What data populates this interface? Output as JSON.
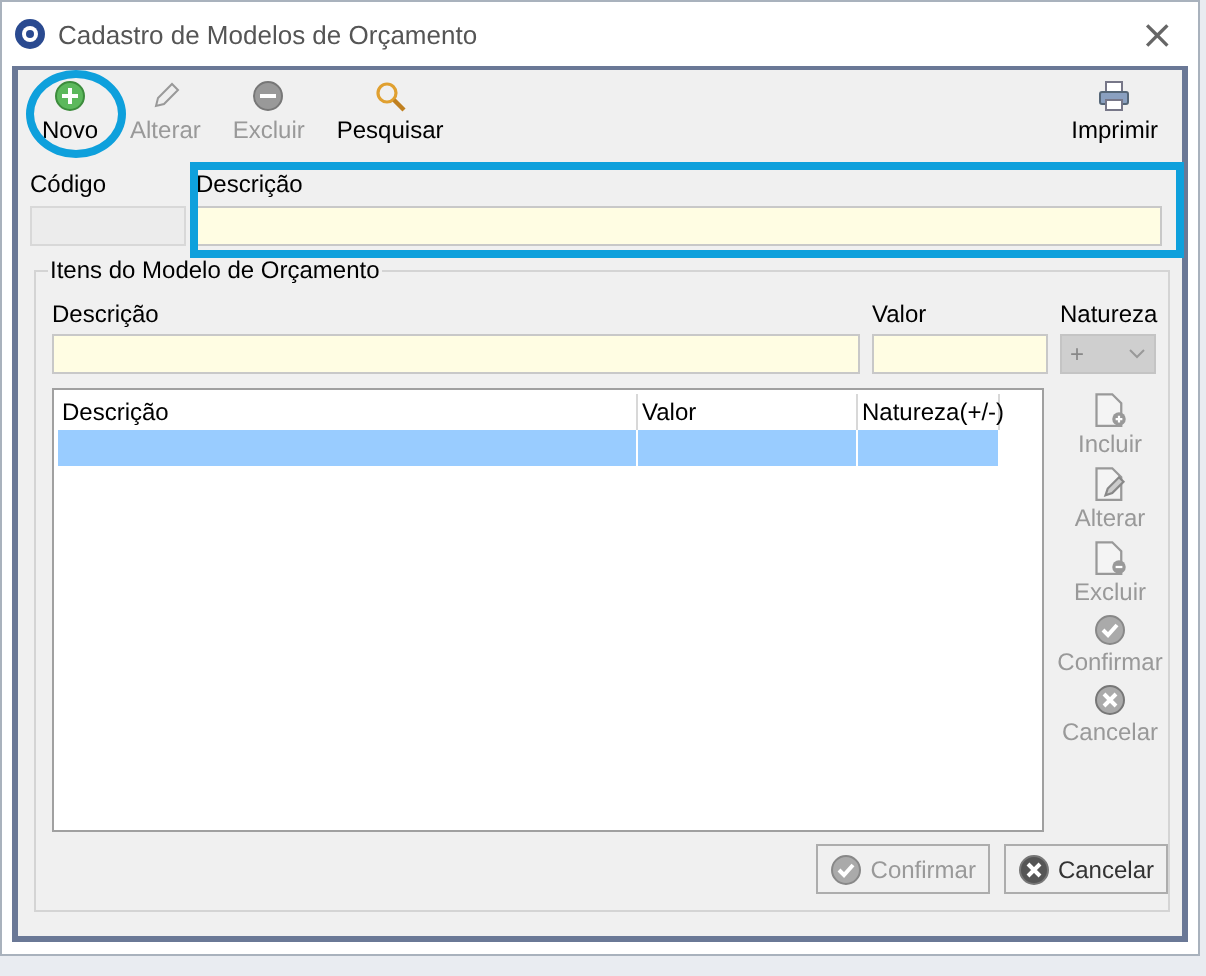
{
  "window": {
    "title": "Cadastro de Modelos de Orçamento",
    "close": "×"
  },
  "toolbar": [
    {
      "kind": "add",
      "label": "Novo",
      "disabled": false,
      "highlighted": true
    },
    {
      "kind": "edit",
      "label": "Alterar",
      "disabled": true,
      "highlighted": false
    },
    {
      "kind": "delete",
      "label": "Excluir",
      "disabled": true,
      "highlighted": false
    },
    {
      "kind": "search",
      "label": "Pesquisar",
      "disabled": false,
      "highlighted": false
    },
    {
      "kind": "print",
      "label": "Imprimir",
      "disabled": false,
      "highlighted": false
    }
  ],
  "header": {
    "code_label": "Código",
    "code_disabled": true,
    "description_label": "Descrição",
    "description_highlighted": true
  },
  "items_group": {
    "title": "Itens do Modelo de Orçamento",
    "description_label": "Descrição",
    "value_label": "Valor",
    "nature_label": "Natureza",
    "nature_value": "+",
    "nature_disabled": true,
    "table": {
      "columns": [
        "Descrição",
        "Valor",
        "Natureza(+/-)"
      ],
      "rows": [
        {
          "selected": true
        }
      ]
    },
    "side_buttons": [
      {
        "kind": "add",
        "label": "Incluir",
        "disabled": true
      },
      {
        "kind": "edit",
        "label": "Alterar",
        "disabled": true
      },
      {
        "kind": "delete",
        "label": "Excluir",
        "disabled": true
      },
      {
        "kind": "confirm",
        "label": "Confirmar",
        "disabled": true
      },
      {
        "kind": "cancel",
        "label": "Cancelar",
        "disabled": true
      }
    ]
  },
  "buttons": [
    {
      "kind": "confirm",
      "label": "Confirmar",
      "disabled": true
    },
    {
      "kind": "cancel",
      "label": "Cancelar",
      "disabled": false
    }
  ]
}
